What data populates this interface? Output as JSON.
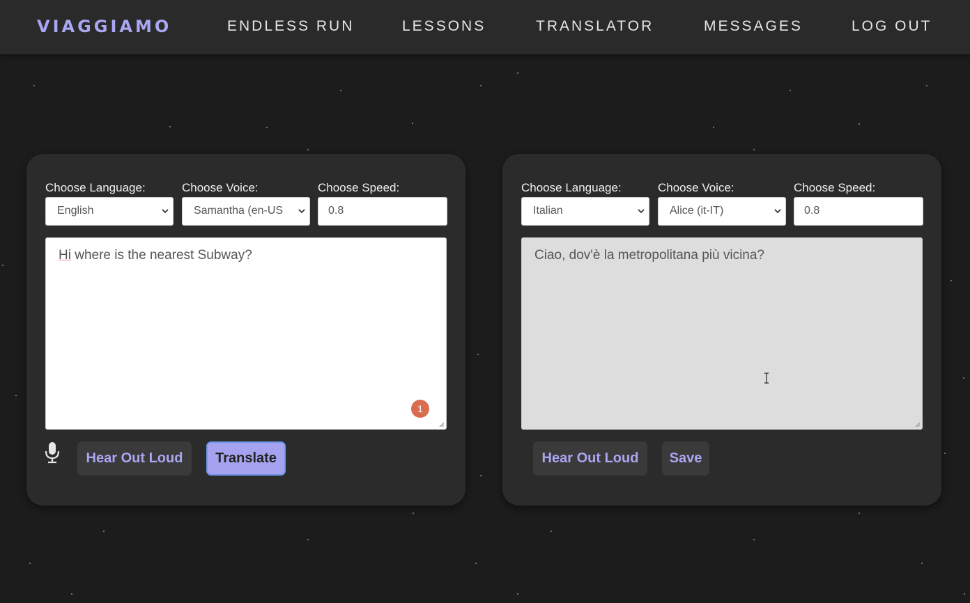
{
  "nav": {
    "brand": "VIAGGIAMO",
    "links": [
      "ENDLESS RUN",
      "LESSONS",
      "TRANSLATOR",
      "MESSAGES",
      "LOG OUT"
    ]
  },
  "source_panel": {
    "language_label": "Choose Language:",
    "voice_label": "Choose Voice:",
    "speed_label": "Choose Speed:",
    "language_value": "English",
    "voice_value": "Samantha (en-US",
    "speed_value": "0.8",
    "text_first_word": "Hi",
    "text_rest": " where is the nearest Subway?",
    "badge_count": "1",
    "mic_icon": "microphone-icon",
    "hear_button": "Hear Out Loud",
    "translate_button": "Translate"
  },
  "target_panel": {
    "language_label": "Choose Language:",
    "voice_label": "Choose Voice:",
    "speed_label": "Choose Speed:",
    "language_value": "Italian",
    "voice_value": "Alice (it-IT)",
    "speed_value": "0.8",
    "text": "Ciao, dov'è la metropolitana più vicina?",
    "hear_button": "Hear Out Loud",
    "save_button": "Save"
  },
  "colors": {
    "accent": "#a9a6f2",
    "primary_button": "#a5a3ef",
    "badge": "#d86d50",
    "background": "#1c1c1c",
    "panel": "#2b2b2b"
  }
}
